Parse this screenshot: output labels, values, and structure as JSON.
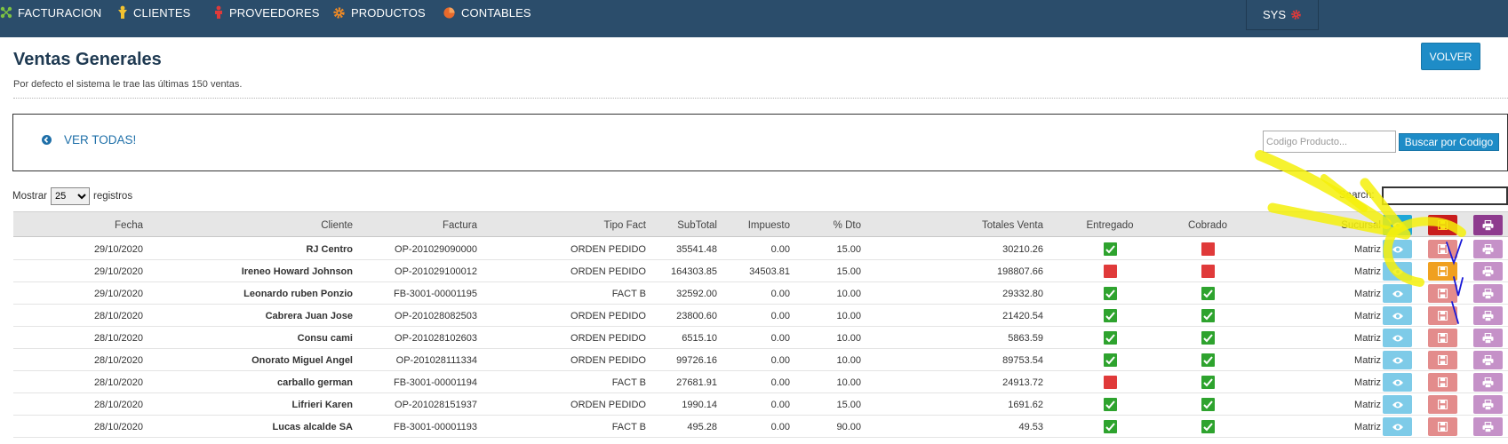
{
  "nav": {
    "items": [
      {
        "label": "FACTURACION",
        "icon": "network-icon"
      },
      {
        "label": "CLIENTES",
        "icon": "person-icon"
      },
      {
        "label": "PROVEEDORES",
        "icon": "person-icon"
      },
      {
        "label": "PRODUCTOS",
        "icon": "gear-icon"
      },
      {
        "label": "CONTABLES",
        "icon": "pie-chart-icon"
      }
    ],
    "user": "SYS"
  },
  "header": {
    "title": "Ventas Generales",
    "subtitle": "Por defecto el sistema le trae las últimas 150 ventas.",
    "volver_label": "VOLVER"
  },
  "panel": {
    "ver_todas": "VER TODAS!",
    "codigo_placeholder": "Codigo Producto...",
    "buscar_label": "Buscar por Codigo"
  },
  "controls": {
    "mostrar_label": "Mostrar",
    "page_size": "25",
    "registros_label": "registros",
    "search_label": "Search:"
  },
  "table": {
    "headers": {
      "fecha": "Fecha",
      "cliente": "Cliente",
      "factura": "Factura",
      "tipo": "Tipo Fact",
      "subtotal": "SubTotal",
      "impuesto": "Impuesto",
      "dto": "% Dto",
      "totales": "Totales Venta",
      "entregado": "Entregado",
      "cobrado": "Cobrado",
      "sucursal": "Sucursal"
    },
    "rows": [
      {
        "fecha": "29/10/2020",
        "cliente": "RJ Centro",
        "factura": "OP-201029090000",
        "tipo": "ORDEN PEDIDO",
        "subtotal": "35541.48",
        "impuesto": "0.00",
        "dto": "15.00",
        "total": "30210.26",
        "entregado": true,
        "cobrado": false,
        "sucursal": "Matriz"
      },
      {
        "fecha": "29/10/2020",
        "cliente": "Ireneo Howard Johnson",
        "factura": "OP-201029100012",
        "tipo": "ORDEN PEDIDO",
        "subtotal": "164303.85",
        "impuesto": "34503.81",
        "dto": "15.00",
        "total": "198807.66",
        "entregado": false,
        "cobrado": false,
        "sucursal": "Matriz"
      },
      {
        "fecha": "29/10/2020",
        "cliente": "Leonardo ruben Ponzio",
        "factura": "FB-3001-00001195",
        "tipo": "FACT B",
        "subtotal": "32592.00",
        "impuesto": "0.00",
        "dto": "10.00",
        "total": "29332.80",
        "entregado": true,
        "cobrado": true,
        "sucursal": "Matriz"
      },
      {
        "fecha": "28/10/2020",
        "cliente": "Cabrera Juan Jose",
        "factura": "OP-201028082503",
        "tipo": "ORDEN PEDIDO",
        "subtotal": "23800.60",
        "impuesto": "0.00",
        "dto": "10.00",
        "total": "21420.54",
        "entregado": true,
        "cobrado": true,
        "sucursal": "Matriz"
      },
      {
        "fecha": "28/10/2020",
        "cliente": "Consu cami",
        "factura": "OP-201028102603",
        "tipo": "ORDEN PEDIDO",
        "subtotal": "6515.10",
        "impuesto": "0.00",
        "dto": "10.00",
        "total": "5863.59",
        "entregado": true,
        "cobrado": true,
        "sucursal": "Matriz"
      },
      {
        "fecha": "28/10/2020",
        "cliente": "Onorato Miguel Angel",
        "factura": "OP-201028111334",
        "tipo": "ORDEN PEDIDO",
        "subtotal": "99726.16",
        "impuesto": "0.00",
        "dto": "10.00",
        "total": "89753.54",
        "entregado": true,
        "cobrado": true,
        "sucursal": "Matriz"
      },
      {
        "fecha": "28/10/2020",
        "cliente": "carballo german",
        "factura": "FB-3001-00001194",
        "tipo": "FACT B",
        "subtotal": "27681.91",
        "impuesto": "0.00",
        "dto": "10.00",
        "total": "24913.72",
        "entregado": false,
        "cobrado": true,
        "sucursal": "Matriz"
      },
      {
        "fecha": "28/10/2020",
        "cliente": "Lifrieri Karen",
        "factura": "OP-201028151937",
        "tipo": "ORDEN PEDIDO",
        "subtotal": "1990.14",
        "impuesto": "0.00",
        "dto": "15.00",
        "total": "1691.62",
        "entregado": true,
        "cobrado": true,
        "sucursal": "Matriz"
      },
      {
        "fecha": "28/10/2020",
        "cliente": "Lucas alcalde SA",
        "factura": "FB-3001-00001193",
        "tipo": "FACT B",
        "subtotal": "495.28",
        "impuesto": "0.00",
        "dto": "90.00",
        "total": "49.53",
        "entregado": true,
        "cobrado": true,
        "sucursal": "Matriz"
      }
    ]
  },
  "colors": {
    "nav_bg": "#2b4d6b",
    "accent_blue": "#1e8cc7",
    "ok_green": "#2ea32e",
    "no_red": "#e03a3a",
    "highlighter_yellow": "#f5f20a"
  }
}
